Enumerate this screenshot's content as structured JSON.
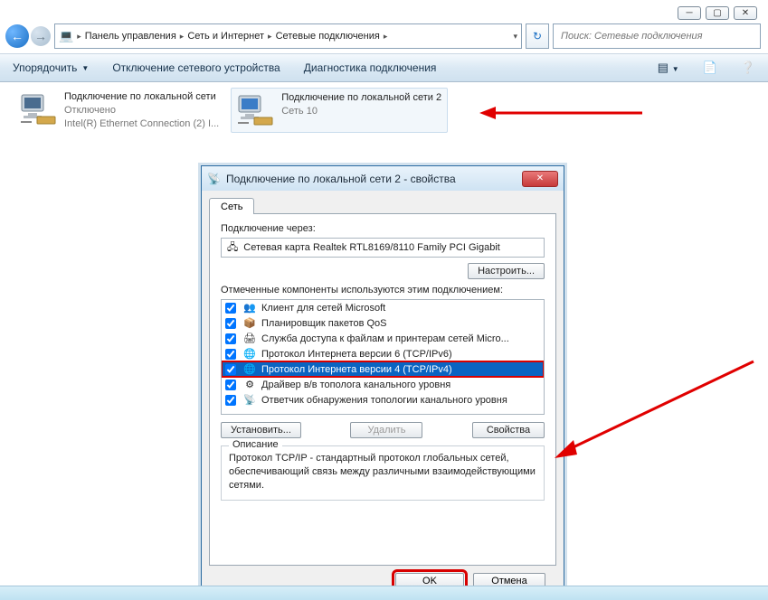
{
  "window": {
    "breadcrumbs": [
      "Панель управления",
      "Сеть и Интернет",
      "Сетевые подключения"
    ],
    "search_placeholder": "Поиск: Сетевые подключения"
  },
  "toolbar": {
    "organize": "Упорядочить",
    "disable": "Отключение сетевого устройства",
    "diagnose": "Диагностика подключения"
  },
  "connections": [
    {
      "name": "Подключение по локальной сети",
      "status": "Отключено",
      "adapter": "Intel(R) Ethernet Connection (2) I..."
    },
    {
      "name": "Подключение по локальной сети 2",
      "status": "Сеть 10",
      "adapter": ""
    }
  ],
  "dialog": {
    "title": "Подключение по локальной сети 2 - свойства",
    "tab": "Сеть",
    "connect_via_label": "Подключение через:",
    "adapter": "Сетевая карта Realtek RTL8169/8110 Family PCI Gigabit",
    "configure": "Настроить...",
    "components_label": "Отмеченные компоненты используются этим подключением:",
    "components": [
      {
        "label": "Клиент для сетей Microsoft",
        "checked": true,
        "hl": false
      },
      {
        "label": "Планировщик пакетов QoS",
        "checked": true,
        "hl": false
      },
      {
        "label": "Служба доступа к файлам и принтерам сетей Micro...",
        "checked": true,
        "hl": false
      },
      {
        "label": "Протокол Интернета версии 6 (TCP/IPv6)",
        "checked": true,
        "hl": false
      },
      {
        "label": "Протокол Интернета версии 4 (TCP/IPv4)",
        "checked": true,
        "hl": true
      },
      {
        "label": "Драйвер в/в тополога канального уровня",
        "checked": true,
        "hl": false
      },
      {
        "label": "Ответчик обнаружения топологии канального уровня",
        "checked": true,
        "hl": false
      }
    ],
    "install": "Установить...",
    "remove": "Удалить",
    "properties": "Свойства",
    "desc_legend": "Описание",
    "desc_text": "Протокол TCP/IP - стандартный протокол глобальных сетей, обеспечивающий связь между различными взаимодействующими сетями.",
    "ok": "OK",
    "cancel": "Отмена"
  }
}
